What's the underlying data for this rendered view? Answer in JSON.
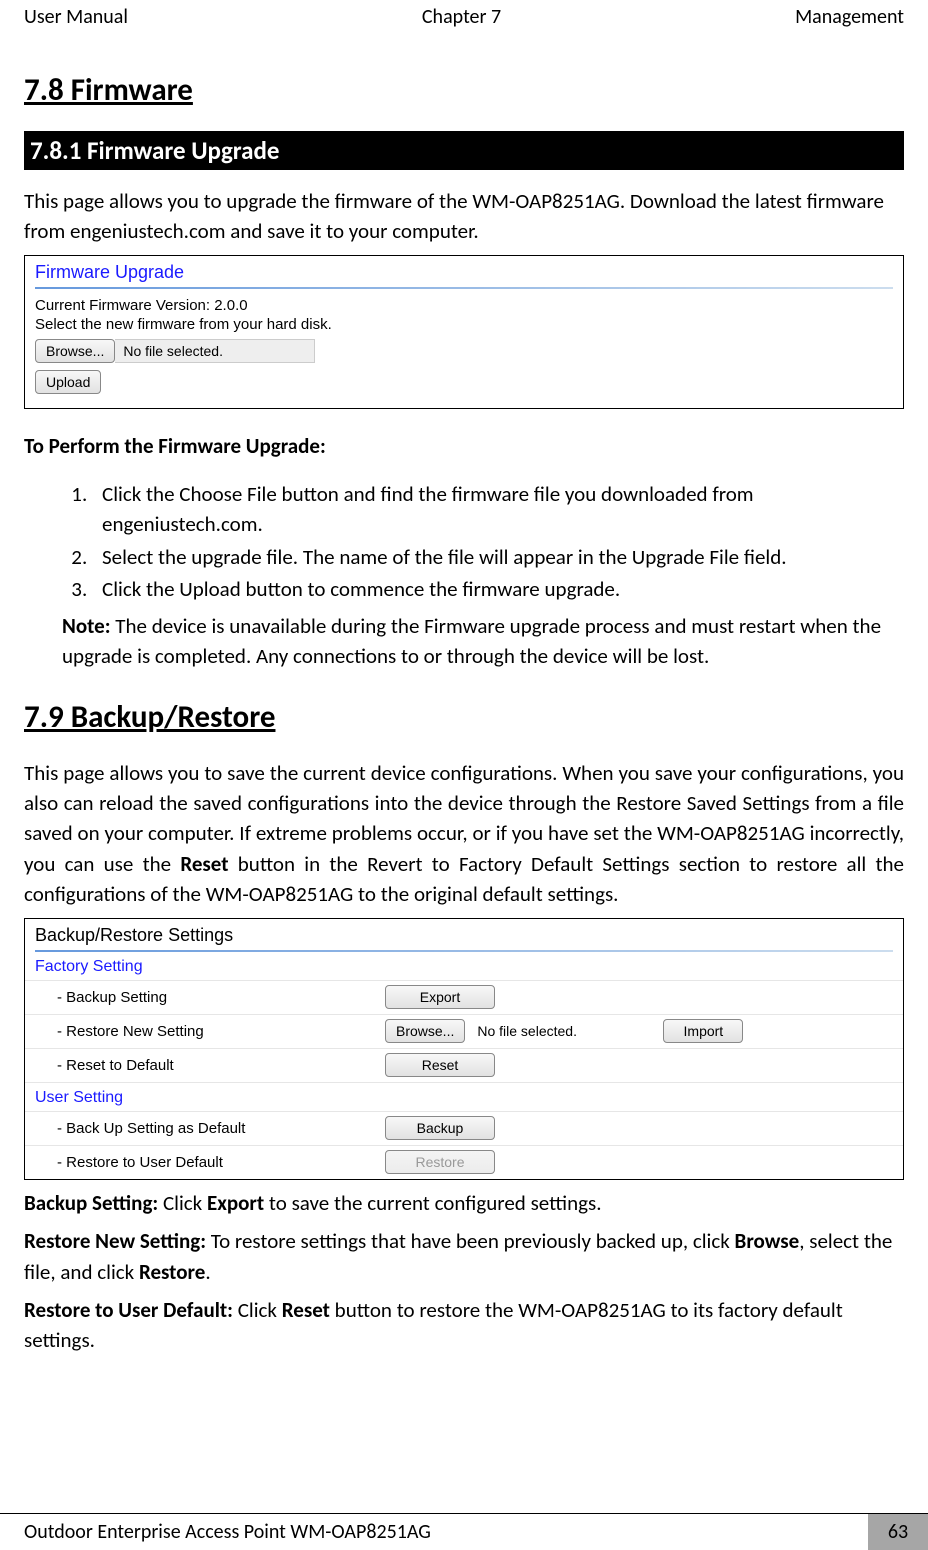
{
  "header": {
    "left": "User Manual",
    "center": "Chapter 7",
    "right": "Management"
  },
  "s78": {
    "title": "7.8 Firmware",
    "sub_title": "7.8.1 Firmware Upgrade",
    "intro": "This page allows you to upgrade the firmware of the WM-OAP8251AG. Download the latest firmware from engeniustech.com and save it to your computer.",
    "shot": {
      "title": "Firmware Upgrade",
      "version_line": "Current Firmware Version: 2.0.0",
      "select_line": "Select the new firmware from your hard disk.",
      "browse_btn": "Browse...",
      "file_text": "No file selected.",
      "upload_btn": "Upload"
    },
    "perform_heading": "To Perform the Firmware Upgrade:",
    "steps": [
      "Click the Choose File button and find the firmware file you downloaded from engeniustech.com.",
      "Select the upgrade file. The name of the file will appear in the Upgrade File field.",
      "Click the Upload button to commence the firmware upgrade."
    ],
    "note_label": "Note:",
    "note_text": " The device is unavailable during the Firmware upgrade process and must restart when the upgrade is completed. Any connections to or through the device will be lost."
  },
  "s79": {
    "title": "7.9 Backup/Restore",
    "intro_p1": "This page allows you to save the current device configurations. When you save your configurations, you also can reload the saved configurations into the device through the Restore Saved Settings from a file saved on your computer. If extreme problems occur, or if you have set the WM-OAP8251AG incorrectly, you can use the ",
    "intro_b1": "Reset",
    "intro_p2": " button in the Revert to Factory Default Settings section to restore all the configurations of the WM-OAP8251AG to the original default settings.",
    "shot": {
      "title": "Backup/Restore Settings",
      "factory_label": "Factory Setting",
      "rows_factory": [
        {
          "label": "- Backup Setting",
          "btn1": "Export"
        },
        {
          "label": "- Restore New Setting",
          "btn1": "Browse...",
          "file_text": "No file selected.",
          "btn2": "Import"
        },
        {
          "label": "- Reset to Default",
          "btn1": "Reset"
        }
      ],
      "user_label": "User Setting",
      "rows_user": [
        {
          "label": "- Back Up Setting as Default",
          "btn1": "Backup"
        },
        {
          "label": "- Restore to User Default",
          "btn1": "Restore",
          "disabled": true
        }
      ]
    },
    "definitions": {
      "backup_label": "Backup Setting:",
      "backup_text": " Click ",
      "backup_b": "Export",
      "backup_text2": " to save the current configured settings.",
      "restore_label": "Restore New Setting:",
      "restore_text": " To restore settings that have been previously backed up, click ",
      "restore_b1": "Browse",
      "restore_text2": ", select the file, and click ",
      "restore_b2": "Restore",
      "restore_text3": ".",
      "reset_label": "Restore to User Default:",
      "reset_text": " Click ",
      "reset_b": "Reset",
      "reset_text2": " button to restore the WM-OAP8251AG to its factory default settings."
    }
  },
  "footer": {
    "text": "Outdoor Enterprise Access Point WM-OAP8251AG",
    "page": "63"
  }
}
